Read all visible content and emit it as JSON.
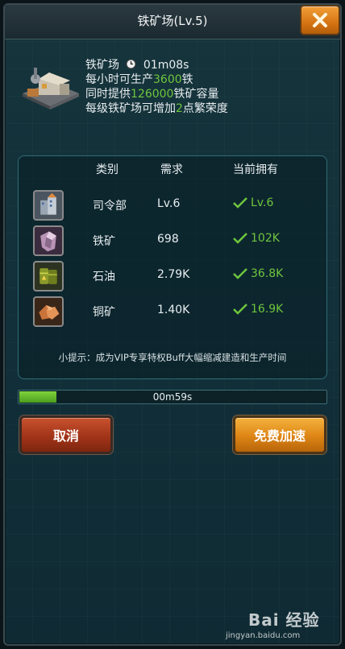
{
  "window": {
    "title": "铁矿场(Lv.5)",
    "close_icon": "close-x-icon"
  },
  "building": {
    "name": "铁矿场",
    "timer": "01m08s",
    "line2_prefix": "每小时可生产",
    "line2_value": "3600",
    "line2_suffix": "铁",
    "line3_prefix": "同时提供",
    "line3_value": "126000",
    "line3_suffix": "铁矿容量",
    "line4_prefix": "每级铁矿场可增加",
    "line4_value": "2",
    "line4_suffix": "点繁荣度"
  },
  "requirements": {
    "headers": {
      "category": "类别",
      "need": "需求",
      "have": "当前拥有"
    },
    "rows": [
      {
        "icon": "headquarters-icon",
        "name": "司令部",
        "need": "Lv.6",
        "have": "Lv.6"
      },
      {
        "icon": "iron-ore-icon",
        "name": "铁矿",
        "need": "698",
        "have": "102K"
      },
      {
        "icon": "oil-barrel-icon",
        "name": "石油",
        "need": "2.79K",
        "have": "36.8K"
      },
      {
        "icon": "copper-ore-icon",
        "name": "铜矿",
        "need": "1.40K",
        "have": "16.9K"
      }
    ],
    "tip": "小提示：成为VIP专享特权Buff大幅缩减建造和生产时间"
  },
  "progress": {
    "value": 0.12,
    "label": "00m59s"
  },
  "buttons": {
    "cancel": "取消",
    "speedup": "免费加速"
  },
  "watermark": {
    "logo": "Bai 经验",
    "url": "jingyan.baidu.com"
  },
  "colors": {
    "highlight_green": "#6ec63d",
    "cancel_red": "#a23418",
    "speed_orange": "#dd8515"
  }
}
